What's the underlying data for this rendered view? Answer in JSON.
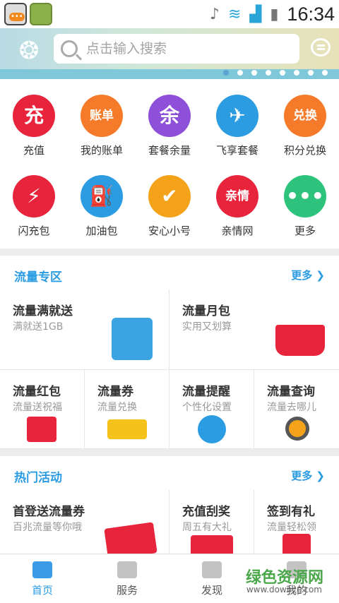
{
  "status_bar": {
    "time": "16:34"
  },
  "header": {
    "search_placeholder": "点击输入搜索",
    "carousel_dots": 8,
    "active_dot": 0
  },
  "quick_icons": [
    {
      "label": "充值",
      "glyph": "充",
      "color": "#e8243c",
      "icon": "recharge-icon"
    },
    {
      "label": "我的账单",
      "glyph": "账单",
      "color": "#f57b2a",
      "icon": "bill-icon"
    },
    {
      "label": "套餐余量",
      "glyph": "余",
      "color": "#8e4fd9",
      "icon": "balance-icon"
    },
    {
      "label": "飞享套餐",
      "glyph": "✈",
      "color": "#2b9be2",
      "icon": "plane-icon"
    },
    {
      "label": "积分兑换",
      "glyph": "兑换",
      "color": "#f57b2a",
      "icon": "gift-icon"
    },
    {
      "label": "闪充包",
      "glyph": "⚡",
      "color": "#e8243c",
      "icon": "flash-icon"
    },
    {
      "label": "加油包",
      "glyph": "⛽",
      "color": "#2b9be2",
      "icon": "fuel-icon"
    },
    {
      "label": "安心小号",
      "glyph": "✔",
      "color": "#f4a21a",
      "icon": "shield-icon"
    },
    {
      "label": "亲情网",
      "glyph": "亲情",
      "color": "#e8243c",
      "icon": "family-icon"
    },
    {
      "label": "更多",
      "glyph": "•••",
      "color": "#2ec37c",
      "icon": "more-icon"
    }
  ],
  "traffic_section": {
    "title": "流量专区",
    "more": "更多",
    "big_cards": [
      {
        "title": "流量满就送",
        "subtitle": "满就送1GB"
      },
      {
        "title": "流量月包",
        "subtitle": "实用又划算"
      }
    ],
    "small_cards": [
      {
        "title": "流量红包",
        "subtitle": "流量送祝福"
      },
      {
        "title": "流量券",
        "subtitle": "流量兑换"
      },
      {
        "title": "流量提醒",
        "subtitle": "个性化设置"
      },
      {
        "title": "流量查询",
        "subtitle": "流量去哪儿"
      }
    ]
  },
  "hot_section": {
    "title": "热门活动",
    "more": "更多",
    "cards": [
      {
        "title": "首登送流量券",
        "subtitle": "百兆流量等你哦"
      },
      {
        "title": "充值刮奖",
        "subtitle": "周五有大礼"
      },
      {
        "title": "签到有礼",
        "subtitle": "流量轻松领"
      }
    ]
  },
  "tabs": [
    {
      "label": "首页",
      "active": true
    },
    {
      "label": "服务",
      "active": false
    },
    {
      "label": "发现",
      "active": false
    },
    {
      "label": "我的",
      "active": false
    }
  ],
  "watermark": {
    "text": "绿色资源网",
    "url": "www.downcc.com"
  },
  "theme": {
    "accent": "#2b9be2"
  }
}
